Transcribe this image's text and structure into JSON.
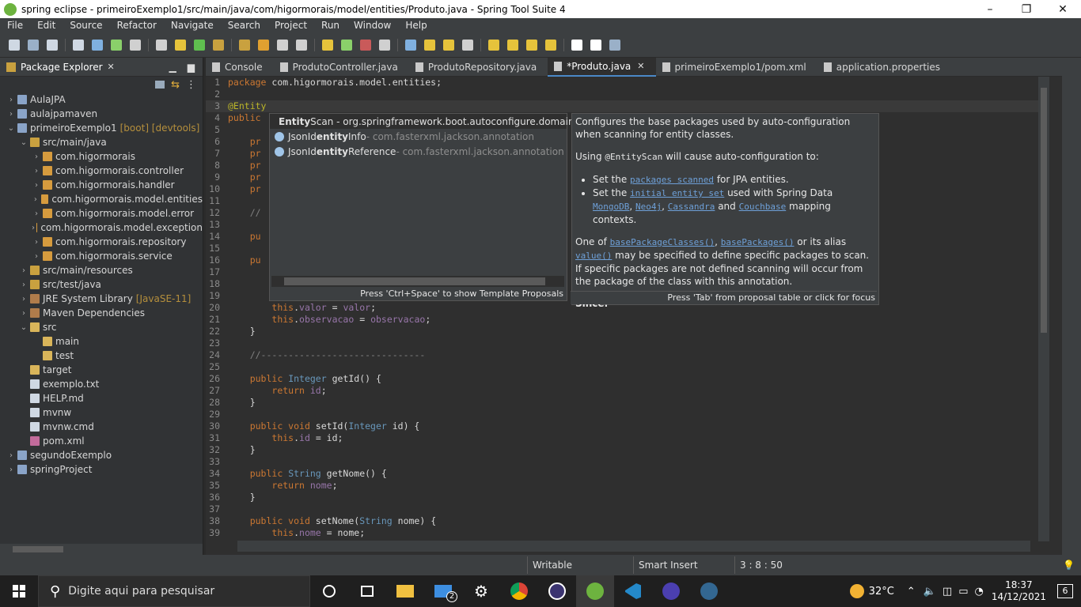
{
  "window": {
    "title": "spring eclipse - primeiroExemplo1/src/main/java/com/higormorais/model/entities/Produto.java - Spring Tool Suite 4",
    "minimize": "–",
    "restore": "❐",
    "close": "✕"
  },
  "menu": [
    "File",
    "Edit",
    "Source",
    "Refactor",
    "Navigate",
    "Search",
    "Project",
    "Run",
    "Window",
    "Help"
  ],
  "explorer": {
    "tab_label": "Package Explorer",
    "close": "✕",
    "items": [
      {
        "label": "AulaJPA",
        "indent": 0,
        "arrow": "›",
        "extra": "",
        "color": "#8aa4c8"
      },
      {
        "label": "aulajpamaven",
        "indent": 0,
        "arrow": "›",
        "extra": "",
        "color": "#8aa4c8"
      },
      {
        "label": "primeiroExemplo1",
        "indent": 0,
        "arrow": "⌄",
        "extra": "[boot] [devtools]",
        "color": "#8aa4c8"
      },
      {
        "label": "src/main/java",
        "indent": 1,
        "arrow": "⌄",
        "extra": "",
        "color": "#c9a13f"
      },
      {
        "label": "com.higormorais",
        "indent": 2,
        "arrow": "›",
        "extra": "",
        "color": "#d69b3e"
      },
      {
        "label": "com.higormorais.controller",
        "indent": 2,
        "arrow": "›",
        "extra": "",
        "color": "#d69b3e"
      },
      {
        "label": "com.higormorais.handler",
        "indent": 2,
        "arrow": "›",
        "extra": "",
        "color": "#d69b3e"
      },
      {
        "label": "com.higormorais.model.entities",
        "indent": 2,
        "arrow": "›",
        "extra": "",
        "color": "#d69b3e"
      },
      {
        "label": "com.higormorais.model.error",
        "indent": 2,
        "arrow": "›",
        "extra": "",
        "color": "#d69b3e"
      },
      {
        "label": "com.higormorais.model.exception",
        "indent": 2,
        "arrow": "›",
        "extra": "",
        "color": "#d69b3e"
      },
      {
        "label": "com.higormorais.repository",
        "indent": 2,
        "arrow": "›",
        "extra": "",
        "color": "#d69b3e"
      },
      {
        "label": "com.higormorais.service",
        "indent": 2,
        "arrow": "›",
        "extra": "",
        "color": "#d69b3e"
      },
      {
        "label": "src/main/resources",
        "indent": 1,
        "arrow": "›",
        "extra": "",
        "color": "#c9a13f"
      },
      {
        "label": "src/test/java",
        "indent": 1,
        "arrow": "›",
        "extra": "",
        "color": "#c9a13f"
      },
      {
        "label": "JRE System Library",
        "indent": 1,
        "arrow": "›",
        "extra": "[JavaSE-11]",
        "color": "#b07c4b"
      },
      {
        "label": "Maven Dependencies",
        "indent": 1,
        "arrow": "›",
        "extra": "",
        "color": "#b07c4b"
      },
      {
        "label": "src",
        "indent": 1,
        "arrow": "⌄",
        "extra": "",
        "color": "#d9b55a"
      },
      {
        "label": "main",
        "indent": 2,
        "arrow": "",
        "extra": "",
        "color": "#d9b55a"
      },
      {
        "label": "test",
        "indent": 2,
        "arrow": "",
        "extra": "",
        "color": "#d9b55a"
      },
      {
        "label": "target",
        "indent": 1,
        "arrow": "",
        "extra": "",
        "color": "#d9b55a"
      },
      {
        "label": "exemplo.txt",
        "indent": 1,
        "arrow": "",
        "extra": "",
        "color": "#cfd8e3"
      },
      {
        "label": "HELP.md",
        "indent": 1,
        "arrow": "",
        "extra": "",
        "color": "#cfd8e3"
      },
      {
        "label": "mvnw",
        "indent": 1,
        "arrow": "",
        "extra": "",
        "color": "#cfd8e3"
      },
      {
        "label": "mvnw.cmd",
        "indent": 1,
        "arrow": "",
        "extra": "",
        "color": "#cfd8e3"
      },
      {
        "label": "pom.xml",
        "indent": 1,
        "arrow": "",
        "extra": "",
        "color": "#c26b9b"
      },
      {
        "label": "segundoExemplo",
        "indent": 0,
        "arrow": "›",
        "extra": "",
        "color": "#8aa4c8"
      },
      {
        "label": "springProject",
        "indent": 0,
        "arrow": "›",
        "extra": "",
        "color": "#8aa4c8"
      }
    ]
  },
  "editor_tabs": [
    {
      "label": "Console",
      "active": false,
      "closable": false
    },
    {
      "label": "ProdutoController.java",
      "active": false,
      "closable": false
    },
    {
      "label": "ProdutoRepository.java",
      "active": false,
      "closable": false
    },
    {
      "label": "*Produto.java",
      "active": true,
      "closable": true
    },
    {
      "label": "primeiroExemplo1/pom.xml",
      "active": false,
      "closable": false
    },
    {
      "label": "application.properties",
      "active": false,
      "closable": false
    }
  ],
  "code_lines": [
    {
      "n": "1",
      "html": "<span class=\"kw\">package</span> com.higormorais.model.entities;"
    },
    {
      "n": "2",
      "html": ""
    },
    {
      "n": "3",
      "html": "<span class=\"ann\">@Entity</span>",
      "current": true
    },
    {
      "n": "4",
      "html": "<span class=\"kw\">public</span>"
    },
    {
      "n": "5",
      "html": ""
    },
    {
      "n": "6",
      "html": "    <span class=\"kw\">pr</span>"
    },
    {
      "n": "7",
      "html": "    <span class=\"kw\">pr</span>"
    },
    {
      "n": "8",
      "html": "    <span class=\"kw\">pr</span>"
    },
    {
      "n": "9",
      "html": "    <span class=\"kw\">pr</span>"
    },
    {
      "n": "10",
      "html": "    <span class=\"kw\">pr</span>"
    },
    {
      "n": "11",
      "html": ""
    },
    {
      "n": "12",
      "html": "    <span class=\"cm\">//</span>"
    },
    {
      "n": "13",
      "html": ""
    },
    {
      "n": "14",
      "html": "    <span class=\"kw\">pu</span>"
    },
    {
      "n": "15",
      "html": ""
    },
    {
      "n": "16",
      "html": "    <span class=\"kw\">pu</span>"
    },
    {
      "n": "17",
      "html": ""
    },
    {
      "n": "18",
      "html": ""
    },
    {
      "n": "19",
      "html": ""
    },
    {
      "n": "20",
      "html": "        <span class=\"kw\">this</span>.<span class=\"fld\">valor</span> = <span class=\"fld\">valor</span>;"
    },
    {
      "n": "21",
      "html": "        <span class=\"kw\">this</span>.<span class=\"fld\">observacao</span> = <span class=\"fld\">observacao</span>;"
    },
    {
      "n": "22",
      "html": "    }"
    },
    {
      "n": "23",
      "html": ""
    },
    {
      "n": "24",
      "html": "    <span class=\"cm\">//------------------------------</span>"
    },
    {
      "n": "25",
      "html": ""
    },
    {
      "n": "26",
      "html": "    <span class=\"kw\">public</span> <span class=\"ty\">Integer</span> getId() {"
    },
    {
      "n": "27",
      "html": "        <span class=\"kw\">return</span> <span class=\"fld\">id</span>;"
    },
    {
      "n": "28",
      "html": "    }"
    },
    {
      "n": "29",
      "html": ""
    },
    {
      "n": "30",
      "html": "    <span class=\"kw\">public void</span> setId(<span class=\"ty\">Integer</span> id) {"
    },
    {
      "n": "31",
      "html": "        <span class=\"kw\">this</span>.<span class=\"fld\">id</span> = id;"
    },
    {
      "n": "32",
      "html": "    }"
    },
    {
      "n": "33",
      "html": ""
    },
    {
      "n": "34",
      "html": "    <span class=\"kw\">public</span> <span class=\"ty\">String</span> getNome() {"
    },
    {
      "n": "35",
      "html": "        <span class=\"kw\">return</span> <span class=\"fld\">nome</span>;"
    },
    {
      "n": "36",
      "html": "    }"
    },
    {
      "n": "37",
      "html": ""
    },
    {
      "n": "38",
      "html": "    <span class=\"kw\">public void</span> setNome(<span class=\"ty\">String</span> nome) {"
    },
    {
      "n": "39",
      "html": "        <span class=\"kw\">this</span>.<span class=\"fld\">nome</span> = nome;"
    }
  ],
  "proposals": {
    "items": [
      {
        "bold": "Entity",
        "rest": "Scan - org.springframework.boot.autoconfigure.domain",
        "qual": "",
        "selected": true
      },
      {
        "bold": "entity",
        "pre": "JsonId",
        "rest": "Info",
        "qual": " - com.fasterxml.jackson.annotation",
        "selected": false
      },
      {
        "bold": "entity",
        "pre": "JsonId",
        "rest": "Reference",
        "qual": " - com.fasterxml.jackson.annotation",
        "selected": false
      }
    ],
    "hint": "Press 'Ctrl+Space' to show Template Proposals"
  },
  "javadoc": {
    "p1": "Configures the base packages used by auto-configuration when scanning for entity classes.",
    "p2_pre": "Using ",
    "p2_code": "@EntityScan",
    "p2_post": " will cause auto-configuration to:",
    "li1_pre": "Set the ",
    "li1_link": "packages scanned",
    "li1_post": " for JPA entities.",
    "li2_pre": "Set the ",
    "li2_link": "initial entity set",
    "li2_mid": " used with Spring Data ",
    "li2_l1": "MongoDB",
    "li2_l2": "Neo4j",
    "li2_l3": "Cassandra",
    "li2_and": " and ",
    "li2_l4": "Couchbase",
    "li2_post": " mapping contexts.",
    "p3_pre": "One of ",
    "p3_l1": "basePackageClasses()",
    "p3_l2": "basePackages()",
    "p3_mid": " or its alias ",
    "p3_l3": "value()",
    "p3_post": " may be specified to define specific packages to scan. If specific packages are not defined scanning will occur from the package of the class with this annotation.",
    "since": "Since:",
    "hint": "Press 'Tab' from proposal table or click for focus"
  },
  "status": {
    "writable": "Writable",
    "insert_mode": "Smart Insert",
    "position": "3 : 8 : 50"
  },
  "taskbar": {
    "search_placeholder": "Digite aqui para pesquisar",
    "temperature": "32°C",
    "time": "18:37",
    "date": "14/12/2021",
    "notifications": "6",
    "mail_badge": "2"
  }
}
